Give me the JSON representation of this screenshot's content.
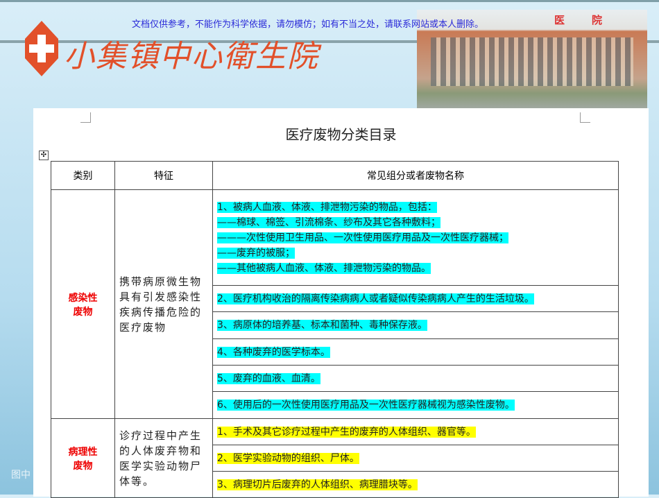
{
  "notice": "文档仅供参考，不能作为科学依据，请勿模仿；如有不当之处，请联系网站或本人删除。",
  "logo_text": "小集镇中心衛生院",
  "photo_sign": [
    "医",
    "院"
  ],
  "document": {
    "title": "医疗废物分类目录",
    "headers": [
      "类别",
      "特征",
      "常见组分或者废物名称"
    ],
    "groups": [
      {
        "category": "感染性\n废物",
        "feature": "携带病原微生物具有引发感染性疾病传播危险的医疗废物",
        "items": [
          [
            "1、被病人血液、体液、排泄物污染的物品，包括：",
            "——棉球、棉签、引流棉条、纱布及其它各种敷料；",
            "———次性使用卫生用品、一次性使用医疗用品及一次性医疗器械；",
            "——废弃的被服；",
            "——其他被病人血液、体液、排泄物污染的物品。"
          ],
          [
            "2、医疗机构收治的隔离传染病病人或者疑似传染病病人产生的生活垃圾。"
          ],
          [
            "3、病原体的培养基、标本和菌种、毒种保存液。"
          ],
          [
            "4、各种废弃的医学标本。"
          ],
          [
            "5、废弃的血液、血清。"
          ],
          [
            "6、使用后的一次性使用医疗用品及一次性医疗器械视为感染性废物。"
          ]
        ]
      },
      {
        "category": "病理性\n废物",
        "feature": "诊疗过程中产生的人体废弃物和医学实验动物尸体等。",
        "items": [
          [
            "1、手术及其它诊疗过程中产生的废弃的人体组织、器官等。"
          ],
          [
            "2、医学实验动物的组织、尸体。"
          ],
          [
            "3、病理切片后废弃的人体组织、病理腊块等。"
          ]
        ]
      }
    ]
  },
  "caption": "图中"
}
